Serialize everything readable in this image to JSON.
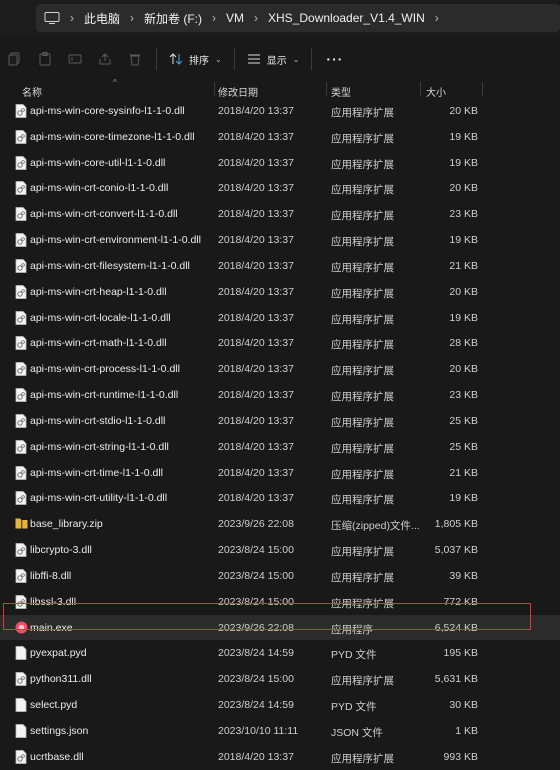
{
  "breadcrumb": [
    "此电脑",
    "新加卷 (F:)",
    "VM",
    "XHS_Downloader_V1.4_WIN"
  ],
  "toolbar": {
    "sort_label": "排序",
    "view_label": "显示",
    "more_label": "···"
  },
  "columns": {
    "name": "名称",
    "date": "修改日期",
    "type": "类型",
    "size": "大小"
  },
  "rows": [
    {
      "name": "api-ms-win-core-sysinfo-l1-1-0.dll",
      "date": "2018/4/20 13:37",
      "type": "应用程序扩展",
      "size": "20 KB",
      "icon": "dll-file-icon"
    },
    {
      "name": "api-ms-win-core-timezone-l1-1-0.dll",
      "date": "2018/4/20 13:37",
      "type": "应用程序扩展",
      "size": "19 KB",
      "icon": "dll-file-icon"
    },
    {
      "name": "api-ms-win-core-util-l1-1-0.dll",
      "date": "2018/4/20 13:37",
      "type": "应用程序扩展",
      "size": "19 KB",
      "icon": "dll-file-icon"
    },
    {
      "name": "api-ms-win-crt-conio-l1-1-0.dll",
      "date": "2018/4/20 13:37",
      "type": "应用程序扩展",
      "size": "20 KB",
      "icon": "dll-file-icon"
    },
    {
      "name": "api-ms-win-crt-convert-l1-1-0.dll",
      "date": "2018/4/20 13:37",
      "type": "应用程序扩展",
      "size": "23 KB",
      "icon": "dll-file-icon"
    },
    {
      "name": "api-ms-win-crt-environment-l1-1-0.dll",
      "date": "2018/4/20 13:37",
      "type": "应用程序扩展",
      "size": "19 KB",
      "icon": "dll-file-icon"
    },
    {
      "name": "api-ms-win-crt-filesystem-l1-1-0.dll",
      "date": "2018/4/20 13:37",
      "type": "应用程序扩展",
      "size": "21 KB",
      "icon": "dll-file-icon"
    },
    {
      "name": "api-ms-win-crt-heap-l1-1-0.dll",
      "date": "2018/4/20 13:37",
      "type": "应用程序扩展",
      "size": "20 KB",
      "icon": "dll-file-icon"
    },
    {
      "name": "api-ms-win-crt-locale-l1-1-0.dll",
      "date": "2018/4/20 13:37",
      "type": "应用程序扩展",
      "size": "19 KB",
      "icon": "dll-file-icon"
    },
    {
      "name": "api-ms-win-crt-math-l1-1-0.dll",
      "date": "2018/4/20 13:37",
      "type": "应用程序扩展",
      "size": "28 KB",
      "icon": "dll-file-icon"
    },
    {
      "name": "api-ms-win-crt-process-l1-1-0.dll",
      "date": "2018/4/20 13:37",
      "type": "应用程序扩展",
      "size": "20 KB",
      "icon": "dll-file-icon"
    },
    {
      "name": "api-ms-win-crt-runtime-l1-1-0.dll",
      "date": "2018/4/20 13:37",
      "type": "应用程序扩展",
      "size": "23 KB",
      "icon": "dll-file-icon"
    },
    {
      "name": "api-ms-win-crt-stdio-l1-1-0.dll",
      "date": "2018/4/20 13:37",
      "type": "应用程序扩展",
      "size": "25 KB",
      "icon": "dll-file-icon"
    },
    {
      "name": "api-ms-win-crt-string-l1-1-0.dll",
      "date": "2018/4/20 13:37",
      "type": "应用程序扩展",
      "size": "25 KB",
      "icon": "dll-file-icon"
    },
    {
      "name": "api-ms-win-crt-time-l1-1-0.dll",
      "date": "2018/4/20 13:37",
      "type": "应用程序扩展",
      "size": "21 KB",
      "icon": "dll-file-icon"
    },
    {
      "name": "api-ms-win-crt-utility-l1-1-0.dll",
      "date": "2018/4/20 13:37",
      "type": "应用程序扩展",
      "size": "19 KB",
      "icon": "dll-file-icon"
    },
    {
      "name": "base_library.zip",
      "date": "2023/9/26 22:08",
      "type": "压缩(zipped)文件...",
      "size": "1,805 KB",
      "icon": "zip-folder-icon"
    },
    {
      "name": "libcrypto-3.dll",
      "date": "2023/8/24 15:00",
      "type": "应用程序扩展",
      "size": "5,037 KB",
      "icon": "dll-file-icon"
    },
    {
      "name": "libffi-8.dll",
      "date": "2023/8/24 15:00",
      "type": "应用程序扩展",
      "size": "39 KB",
      "icon": "dll-file-icon"
    },
    {
      "name": "libssl-3.dll",
      "date": "2023/8/24 15:00",
      "type": "应用程序扩展",
      "size": "772 KB",
      "icon": "dll-file-icon"
    },
    {
      "name": "main.exe",
      "date": "2023/9/26 22:08",
      "type": "应用程序",
      "size": "6,524 KB",
      "icon": "app-icon",
      "selected": true
    },
    {
      "name": "pyexpat.pyd",
      "date": "2023/8/24 14:59",
      "type": "PYD 文件",
      "size": "195 KB",
      "icon": "file-icon"
    },
    {
      "name": "python311.dll",
      "date": "2023/8/24 15:00",
      "type": "应用程序扩展",
      "size": "5,631 KB",
      "icon": "dll-file-icon"
    },
    {
      "name": "select.pyd",
      "date": "2023/8/24 14:59",
      "type": "PYD 文件",
      "size": "30 KB",
      "icon": "file-icon"
    },
    {
      "name": "settings.json",
      "date": "2023/10/10 11:11",
      "type": "JSON 文件",
      "size": "1 KB",
      "icon": "file-icon"
    },
    {
      "name": "ucrtbase.dll",
      "date": "2018/4/20 13:37",
      "type": "应用程序扩展",
      "size": "993 KB",
      "icon": "dll-file-icon"
    }
  ],
  "colors": {
    "background": "#191919",
    "highlight_border": "#d9373b",
    "zip_folder": "#e8b33c",
    "app_icon": "#e8506a"
  }
}
